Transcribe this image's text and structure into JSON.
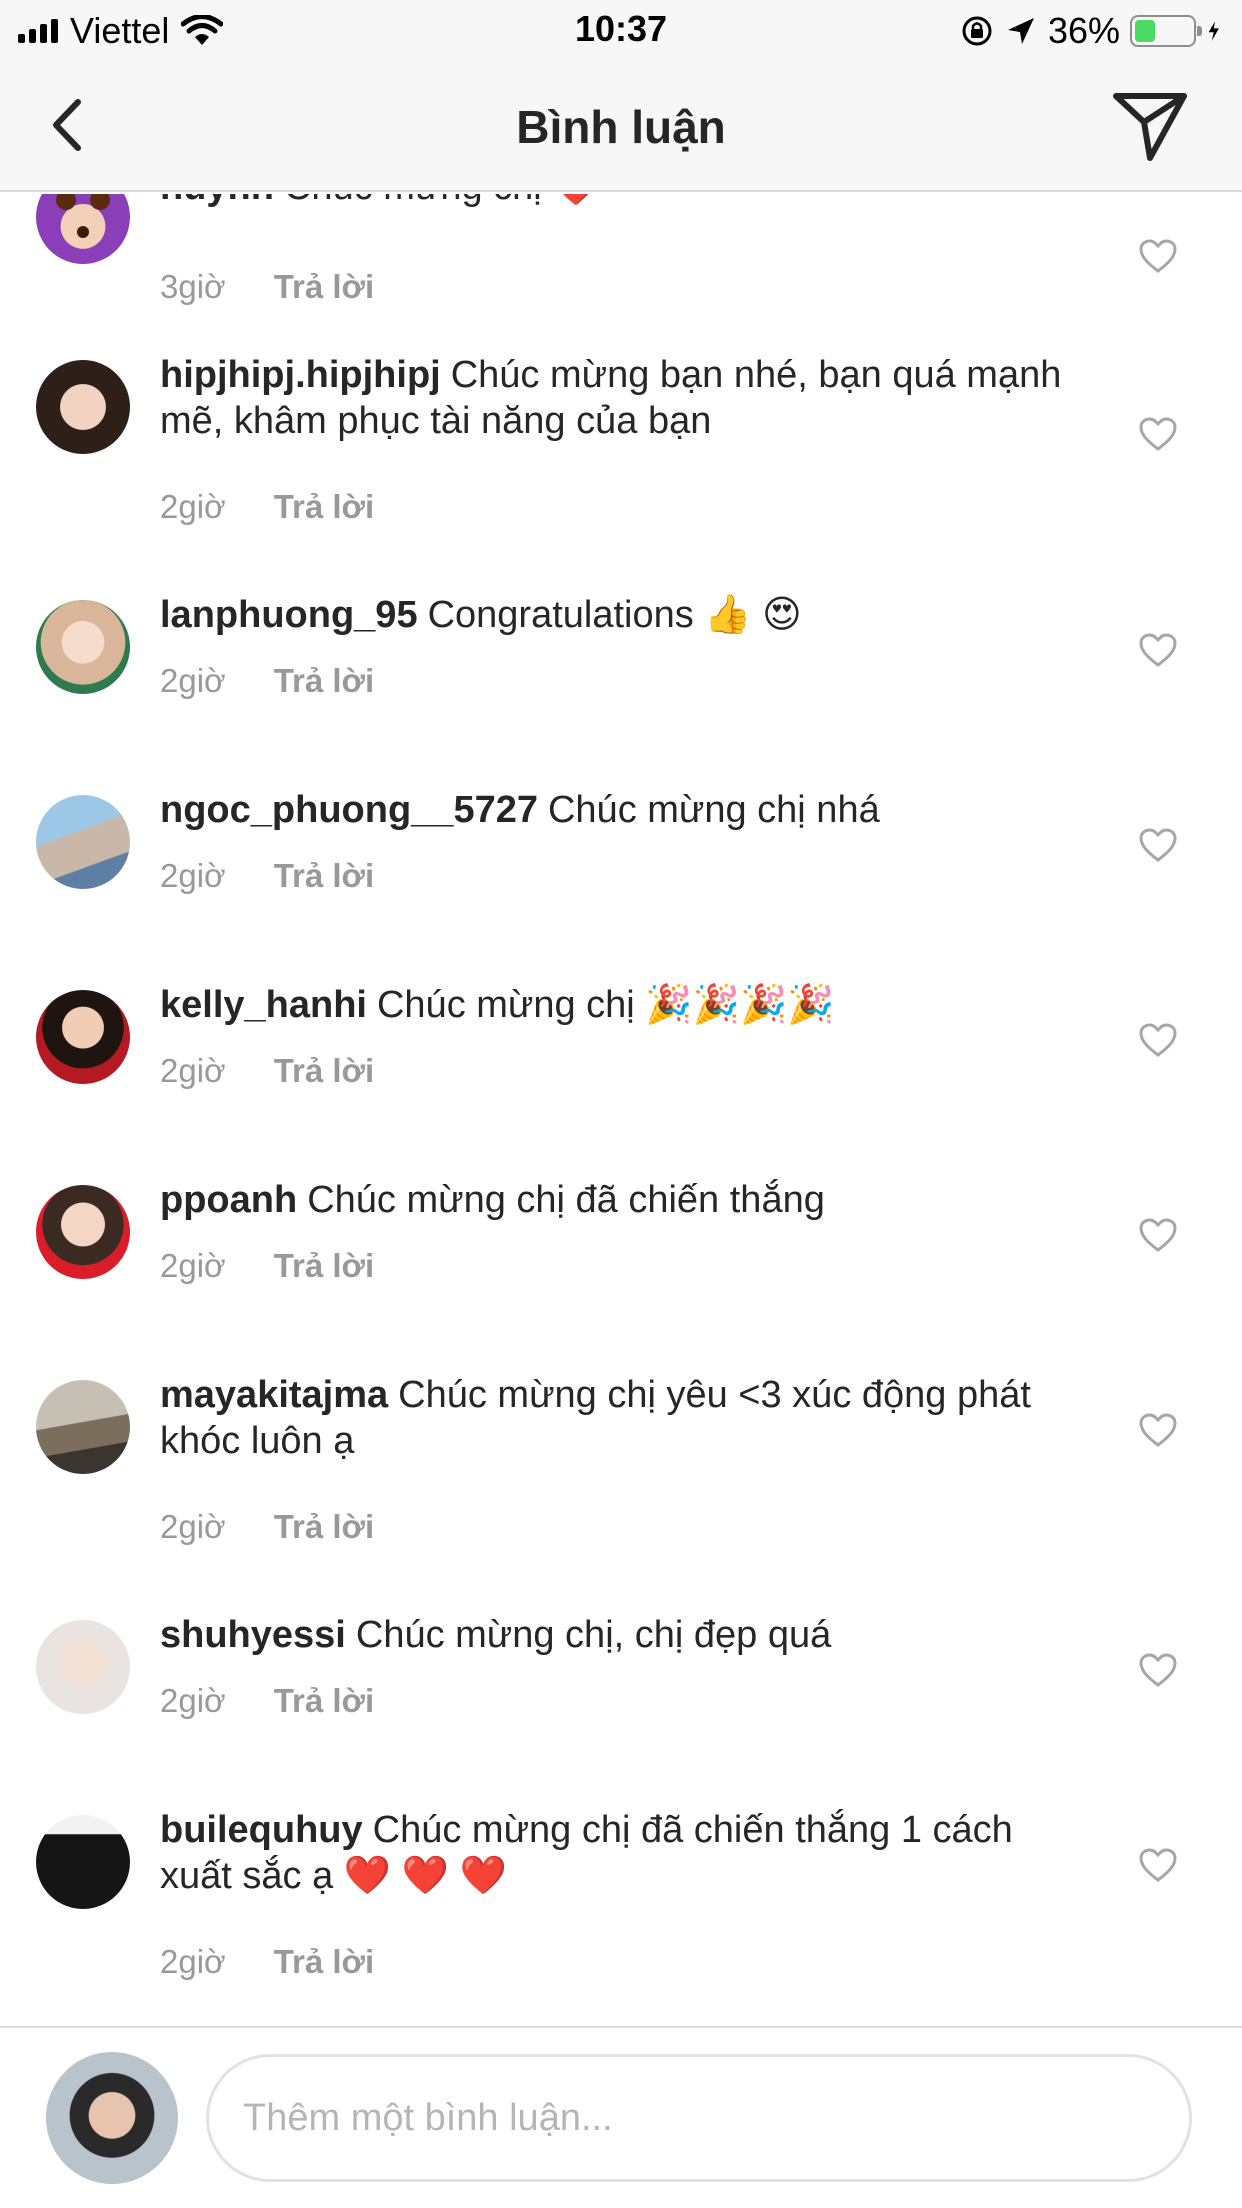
{
  "status_bar": {
    "carrier": "Viettel",
    "time": "10:37",
    "battery_percent": "36%",
    "battery_level": 0.36
  },
  "nav": {
    "title": "Bình luận"
  },
  "colors": {
    "text": "#262626",
    "secondary": "#999999",
    "divider": "#dbdbdb",
    "heart_emoji": "#e0142b"
  },
  "comments": [
    {
      "username": "huynh",
      "text": "Chúc mừng chị",
      "emoji": "❤️",
      "time": "3giờ",
      "reply": "Trả lời"
    },
    {
      "username": "hipjhipj.hipjhipj",
      "text": "Chúc mừng bạn nhé, bạn quá mạnh mẽ, khâm phục tài năng của bạn",
      "emoji": "",
      "time": "2giờ",
      "reply": "Trả lời"
    },
    {
      "username": "lanphuong_95",
      "text": "Congratulations",
      "emoji": "👍 😍",
      "time": "2giờ",
      "reply": "Trả lời"
    },
    {
      "username": "ngoc_phuong__5727",
      "text": "Chúc mừng chị nhá",
      "emoji": "",
      "time": "2giờ",
      "reply": "Trả lời"
    },
    {
      "username": "kelly_hanhi",
      "text": "Chúc mừng chị",
      "emoji": "🎉🎉🎉🎉",
      "time": "2giờ",
      "reply": "Trả lời"
    },
    {
      "username": "ppoanh",
      "text": "Chúc mừng chị đã chiến thắng",
      "emoji": "",
      "time": "2giờ",
      "reply": "Trả lời"
    },
    {
      "username": "mayakitajma",
      "text": "Chúc mừng chị yêu <3 xúc động phát khóc luôn ạ",
      "emoji": "",
      "time": "2giờ",
      "reply": "Trả lời"
    },
    {
      "username": "shuhyessi",
      "text": "Chúc mừng chị, chị đẹp quá",
      "emoji": "",
      "time": "2giờ",
      "reply": "Trả lời"
    },
    {
      "username": "builequhuy",
      "text": "Chúc mừng chị đã chiến thắng 1 cách xuất sắc ạ",
      "emoji": "❤️ ❤️ ❤️",
      "time": "2giờ",
      "reply": "Trả lời"
    }
  ],
  "composer": {
    "placeholder": "Thêm một bình luận..."
  }
}
